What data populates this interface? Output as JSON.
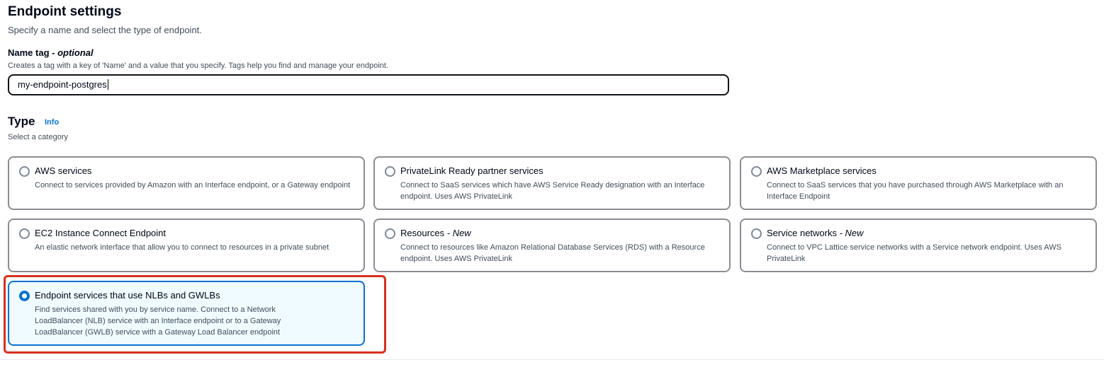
{
  "section": {
    "title": "Endpoint settings",
    "description": "Specify a name and select the type of endpoint."
  },
  "name_tag": {
    "label": "Name tag",
    "optional": "optional",
    "separator": " - ",
    "description": "Creates a tag with a key of 'Name' and a value that you specify. Tags help you find and manage your endpoint.",
    "value": "my-endpoint-postgres"
  },
  "type": {
    "title": "Type",
    "info_link": "Info",
    "description": "Select a category",
    "selected": "Endpoint services that use NLBs and GWLBs",
    "options": [
      {
        "title": "AWS services",
        "new": "",
        "description": "Connect to services provided by Amazon with an Interface endpoint, or a Gateway endpoint"
      },
      {
        "title": "PrivateLink Ready partner services",
        "new": "",
        "description": "Connect to SaaS services which have AWS Service Ready designation with an Interface endpoint. Uses AWS PrivateLink"
      },
      {
        "title": "AWS Marketplace services",
        "new": "",
        "description": "Connect to SaaS services that you have purchased through AWS Marketplace with an Interface Endpoint"
      },
      {
        "title": "EC2 Instance Connect Endpoint",
        "new": "",
        "description": "An elastic network interface that allow you to connect to resources in a private subnet"
      },
      {
        "title": "Resources",
        "new": " - New",
        "description": "Connect to resources like Amazon Relational Database Services (RDS) with a Resource endpoint. Uses AWS PrivateLink"
      },
      {
        "title": "Service networks",
        "new": " - New",
        "description": "Connect to VPC Lattice service networks with a Service network endpoint. Uses AWS PrivateLink"
      },
      {
        "title": "Endpoint services that use NLBs and GWLBs",
        "new": "",
        "description": "Find services shared with you by service name. Connect to a Network LoadBalancer (NLB) service with an Interface endpoint or to a Gateway LoadBalancer (GWLB) service with a Gateway Load Balancer endpoint"
      }
    ]
  },
  "colors": {
    "accent": "#0972d3",
    "highlight_outline": "#d9301e",
    "selected_background": "#f0fbff"
  }
}
